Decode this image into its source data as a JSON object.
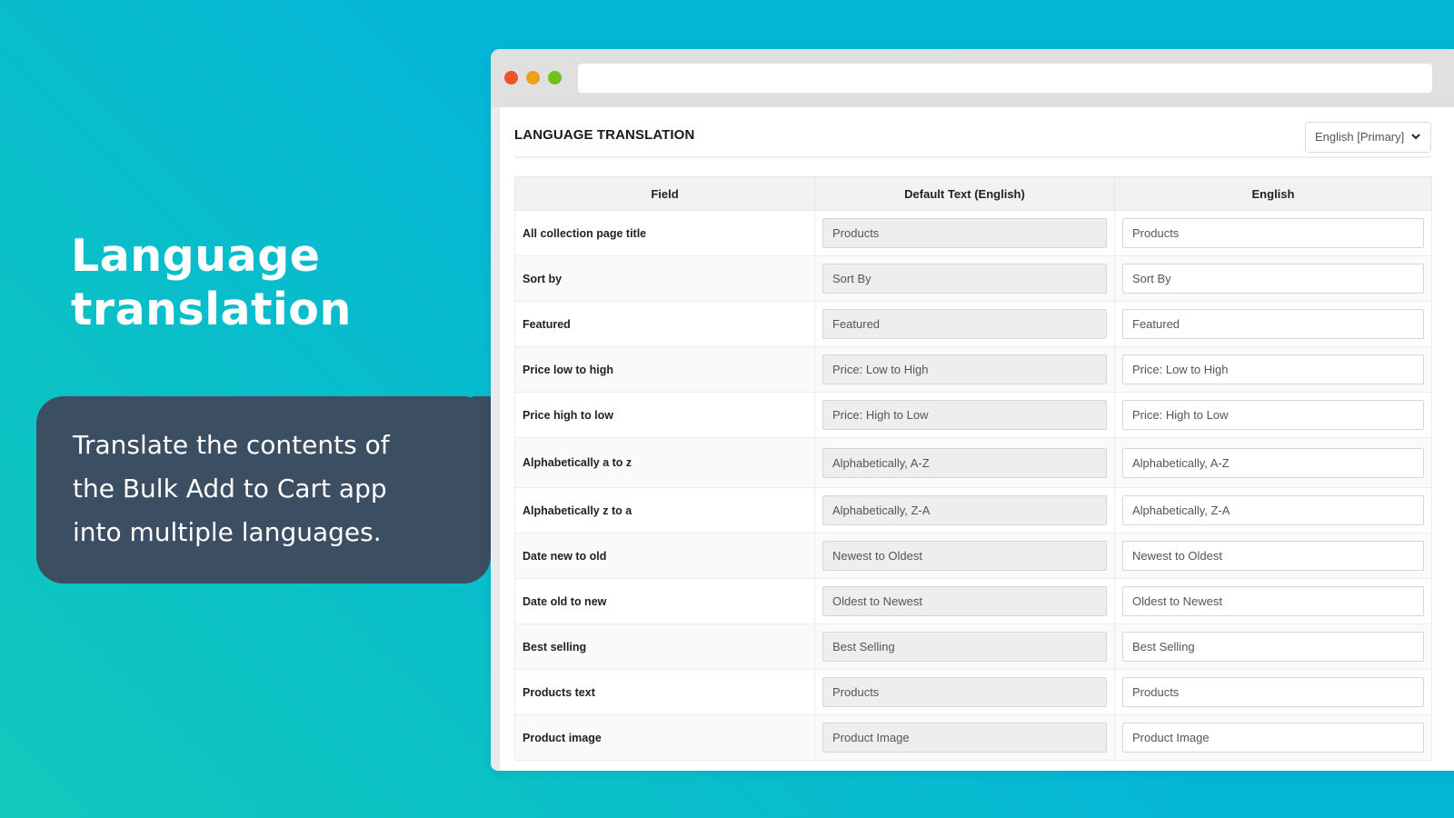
{
  "hero": {
    "title_line1": "Language",
    "title_line2": "translation",
    "description_line1": "Translate the contents of",
    "description_line2": "the Bulk Add to Cart app",
    "description_line3": "into multiple languages."
  },
  "window": {
    "url": "",
    "traffic_lights": [
      "close",
      "minimize",
      "maximize"
    ]
  },
  "page": {
    "title": "LANGUAGE TRANSLATION",
    "language_select": {
      "selected": "English [Primary]",
      "icon": "chevron-down-icon"
    }
  },
  "table": {
    "headers": [
      "Field",
      "Default Text (English)",
      "English"
    ],
    "rows": [
      {
        "field": "All collection page title",
        "default": "Products",
        "translation": "Products"
      },
      {
        "field": "Sort by",
        "default": "Sort By",
        "translation": "Sort By"
      },
      {
        "field": "Featured",
        "default": "Featured",
        "translation": "Featured"
      },
      {
        "field": "Price low to high",
        "default": "Price: Low to High",
        "translation": "Price: Low to High"
      },
      {
        "field": "Price high to low",
        "default": "Price: High to Low",
        "translation": "Price: High to Low"
      },
      {
        "field": "Alphabetically a to z",
        "default": "Alphabetically, A-Z",
        "translation": "Alphabetically, A-Z"
      },
      {
        "field": "Alphabetically z to a",
        "default": "Alphabetically, Z-A",
        "translation": "Alphabetically, Z-A"
      },
      {
        "field": "Date new to old",
        "default": "Newest to Oldest",
        "translation": "Newest to Oldest"
      },
      {
        "field": "Date old to new",
        "default": "Oldest to Newest",
        "translation": "Oldest to Newest"
      },
      {
        "field": "Best selling",
        "default": "Best Selling",
        "translation": "Best Selling"
      },
      {
        "field": "Products text",
        "default": "Products",
        "translation": "Products"
      },
      {
        "field": "Product image",
        "default": "Product Image",
        "translation": "Product Image"
      }
    ]
  },
  "colors": {
    "background_accent": "#03b6d6",
    "bubble": "#3b4e62",
    "close_dot": "#ef5128",
    "minimize_dot": "#eba114",
    "maximize_dot": "#6ec21b"
  }
}
